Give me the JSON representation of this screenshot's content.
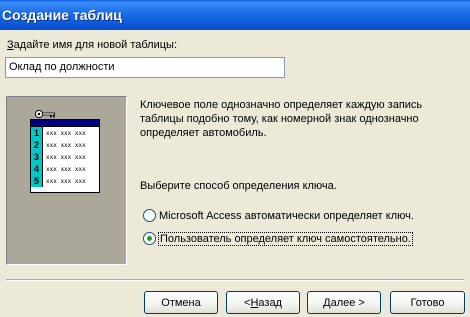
{
  "window": {
    "title": "Создание таблиц"
  },
  "name_section": {
    "label_accel": "З",
    "label_rest": "адайте имя для новой таблицы:",
    "value": "Оклад по должности"
  },
  "illustration": {
    "row_numbers": [
      "1",
      "2",
      "3",
      "4",
      "5"
    ],
    "cell_text": "xxx xxx xxx"
  },
  "description": "Ключевое поле однозначно определяет каждую запись таблицы подобно тому, как номерной знак однозначно определяет автомобиль.",
  "key_prompt": "Выберите способ определения ключа.",
  "options": [
    {
      "label": "Microsoft Access автоматически определяет ключ.",
      "checked": false
    },
    {
      "label": "Пользователь определяет ключ самостоятельно.",
      "checked": true
    }
  ],
  "buttons": {
    "cancel": "Отмена",
    "back_prefix": "< ",
    "back_accel": "Н",
    "back_rest": "азад",
    "next_accel": "Д",
    "next_rest": "алее >",
    "finish": "Готово"
  }
}
